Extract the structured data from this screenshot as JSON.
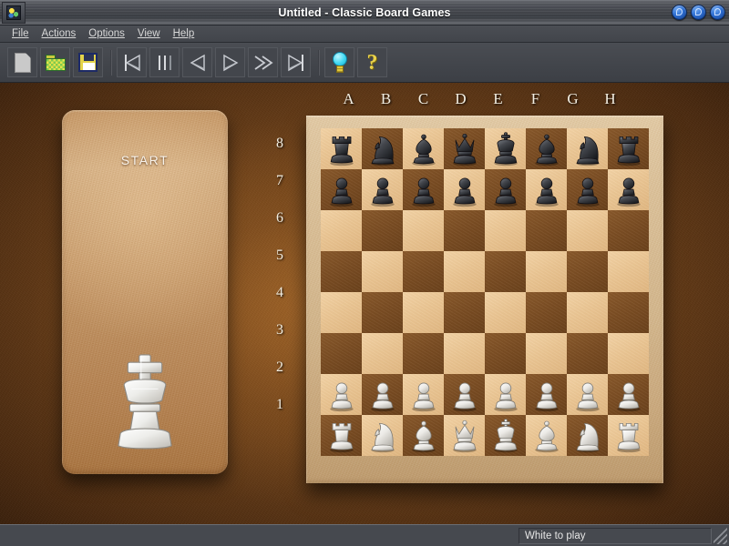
{
  "window": {
    "title": "Untitled - Classic Board Games",
    "app_icon": "chess-app-icon",
    "controls": [
      {
        "name": "minimize-button",
        "glyph": "minimize-icon"
      },
      {
        "name": "maximize-button",
        "glyph": "maximize-icon"
      },
      {
        "name": "close-button",
        "glyph": "close-icon"
      }
    ]
  },
  "menubar": {
    "items": [
      {
        "label": "File",
        "accel": "F"
      },
      {
        "label": "Actions",
        "accel": "A"
      },
      {
        "label": "Options",
        "accel": "O"
      },
      {
        "label": "View",
        "accel": "V"
      },
      {
        "label": "Help",
        "accel": "H"
      }
    ]
  },
  "toolbar": {
    "buttons": [
      {
        "name": "new-game-button",
        "icon": "new-document-icon"
      },
      {
        "name": "open-game-button",
        "icon": "open-folder-icon"
      },
      {
        "name": "save-game-button",
        "icon": "floppy-disk-save-icon"
      },
      {
        "name": "go-to-start-button",
        "icon": "skip-to-start-icon"
      },
      {
        "name": "step-back-button",
        "icon": "step-backward-icon"
      },
      {
        "name": "previous-move-button",
        "icon": "play-backward-icon"
      },
      {
        "name": "next-move-button",
        "icon": "play-forward-icon"
      },
      {
        "name": "fast-forward-button",
        "icon": "fast-forward-icon"
      },
      {
        "name": "go-to-end-button",
        "icon": "skip-to-end-icon"
      },
      {
        "name": "hint-button",
        "icon": "lightbulb-hint-icon"
      },
      {
        "name": "help-button",
        "icon": "question-mark-help-icon"
      }
    ]
  },
  "side_panel": {
    "start_label": "START",
    "piece_icon": "white-king-icon"
  },
  "board": {
    "file_labels": [
      "A",
      "B",
      "C",
      "D",
      "E",
      "F",
      "G",
      "H"
    ],
    "rank_labels": [
      "8",
      "7",
      "6",
      "5",
      "4",
      "3",
      "2",
      "1"
    ],
    "light_square_color": "#e9c492",
    "dark_square_color": "#7a4d23",
    "frame_color": "#d9bf96",
    "position": [
      [
        "br",
        "bn",
        "bb",
        "bq",
        "bk",
        "bb",
        "bn",
        "br"
      ],
      [
        "bp",
        "bp",
        "bp",
        "bp",
        "bp",
        "bp",
        "bp",
        "bp"
      ],
      [
        "",
        "",
        "",
        "",
        "",
        "",
        "",
        ""
      ],
      [
        "",
        "",
        "",
        "",
        "",
        "",
        "",
        ""
      ],
      [
        "",
        "",
        "",
        "",
        "",
        "",
        "",
        ""
      ],
      [
        "",
        "",
        "",
        "",
        "",
        "",
        "",
        ""
      ],
      [
        "wp",
        "wp",
        "wp",
        "wp",
        "wp",
        "wp",
        "wp",
        "wp"
      ],
      [
        "wr",
        "wn",
        "wb",
        "wq",
        "wk",
        "wb",
        "wn",
        "wr"
      ]
    ]
  },
  "statusbar": {
    "message": "White to play",
    "resize_grip": "resize-grip-icon"
  }
}
